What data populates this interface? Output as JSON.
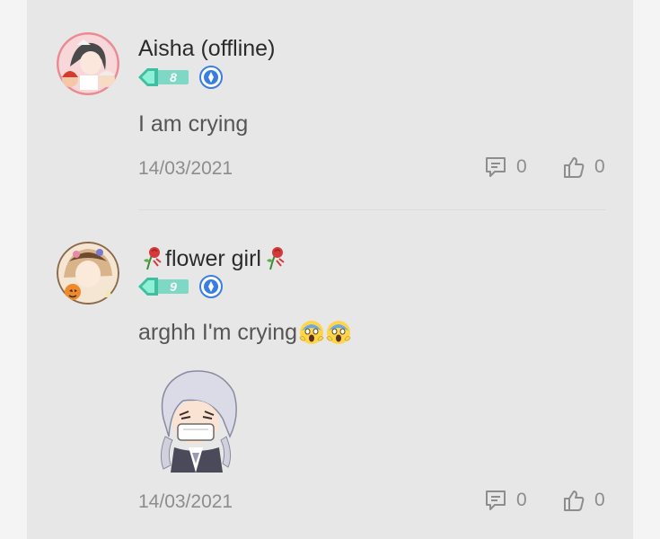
{
  "comments": [
    {
      "username": "Aisha (offline)",
      "level": "8",
      "text": "I am crying",
      "date": "14/03/2021",
      "reply_count": "0",
      "like_count": "0"
    },
    {
      "username": "flower girl",
      "level": "9",
      "text": "arghh I'm crying",
      "date": "14/03/2021",
      "reply_count": "0",
      "like_count": "0"
    }
  ],
  "colors": {
    "level_badge": "#4cc9b0",
    "vip_icon": "#3a7ee0"
  }
}
